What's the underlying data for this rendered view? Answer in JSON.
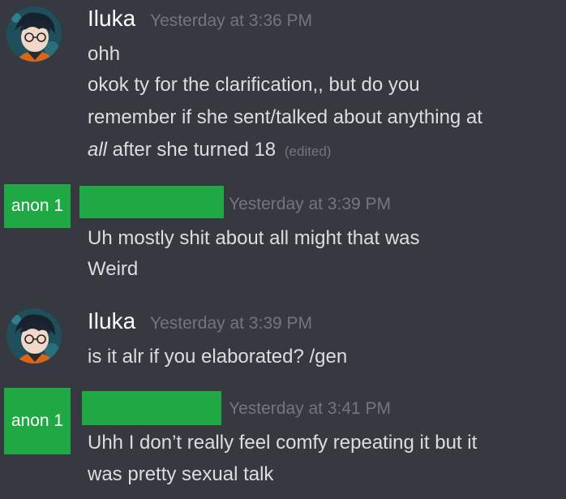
{
  "messages": [
    {
      "author": "Iluka",
      "timestamp": "Yesterday at 3:36 PM",
      "lines": [
        "ohh",
        "okok ty for the clarification,, but do you",
        "remember if she sent/talked about anything at"
      ],
      "last_line_italic": "all",
      "last_line_rest": " after she turned 18",
      "edited": "(edited)"
    },
    {
      "author_redaction_label": "anon 1",
      "timestamp": "Yesterday at 3:39 PM",
      "lines": [
        "Uh mostly shit about all might that was",
        "Weird"
      ]
    },
    {
      "author": "Iluka",
      "timestamp": "Yesterday at 3:39 PM",
      "lines": [
        "is it alr if you elaborated? /gen"
      ]
    },
    {
      "author_redaction_label": "anon 1",
      "timestamp": "Yesterday at 3:41 PM",
      "lines": [
        "Uhh I don’t really feel comfy repeating it but it",
        "was pretty sexual talk"
      ]
    }
  ],
  "colors": {
    "background": "#36393f",
    "redaction": "#1fa844",
    "text": "#dcddde",
    "timestamp": "#72767d",
    "username": "#ffffff"
  }
}
